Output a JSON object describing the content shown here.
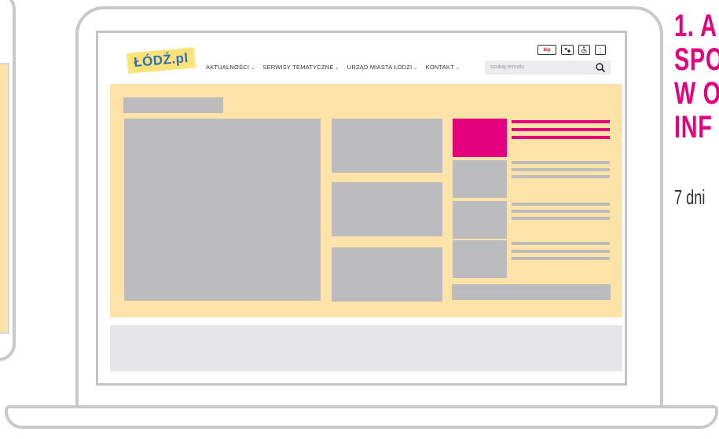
{
  "website": {
    "logo_text": "ŁÓDŹ.pl",
    "nav": [
      {
        "label": "AKTUALNOŚCI"
      },
      {
        "label": "SERWISY TEMATYCZNE"
      },
      {
        "label": "URZĄD MIASTA ŁODZI"
      },
      {
        "label": "KONTAKT"
      }
    ],
    "search": {
      "placeholder": "szukaj tematu"
    },
    "utility_icons": [
      "bip-icon",
      "sign-language-icon",
      "accessibility-icon",
      "more-options-icon"
    ],
    "bip_label": "bip"
  },
  "side_text": {
    "title": "1. A\nSPO\nW O\nINF",
    "subtitle": "7 dni"
  },
  "colors": {
    "accent": "#e5007e",
    "content_bg": "#fde3a7",
    "placeholder": "#bcbcbe",
    "footer_bg": "#e6e6e8",
    "frame": "#c9c9cb"
  }
}
